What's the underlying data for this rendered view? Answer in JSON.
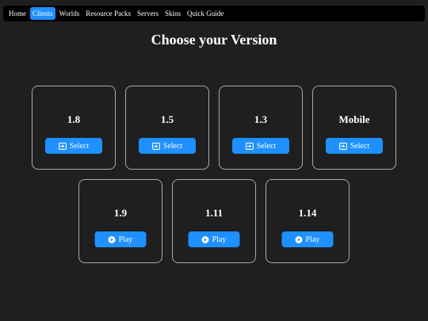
{
  "nav": {
    "items": [
      {
        "label": "Home",
        "active": false
      },
      {
        "label": "Clients",
        "active": true
      },
      {
        "label": "Worlds",
        "active": false
      },
      {
        "label": "Resource Packs",
        "active": false
      },
      {
        "label": "Servers",
        "active": false
      },
      {
        "label": "Skins",
        "active": false
      },
      {
        "label": "Quick Guide",
        "active": false
      }
    ]
  },
  "page": {
    "title": "Choose your Version"
  },
  "clients": [
    {
      "version": "1.8",
      "button_label": "Select",
      "button_icon": "sign-in-icon"
    },
    {
      "version": "1.5",
      "button_label": "Select",
      "button_icon": "sign-in-icon"
    },
    {
      "version": "1.3",
      "button_label": "Select",
      "button_icon": "sign-in-icon"
    },
    {
      "version": "Mobile",
      "button_label": "Select",
      "button_icon": "sign-in-icon"
    },
    {
      "version": "1.9",
      "button_label": "Play",
      "button_icon": "play-circle-icon"
    },
    {
      "version": "1.11",
      "button_label": "Play",
      "button_icon": "play-circle-icon"
    },
    {
      "version": "1.14",
      "button_label": "Play",
      "button_icon": "play-circle-icon"
    }
  ],
  "colors": {
    "background": "#1f1f1f",
    "navbar": "#000000",
    "accent": "#1e90ff",
    "card_border": "#a9a9a9",
    "text": "#ffffff"
  }
}
